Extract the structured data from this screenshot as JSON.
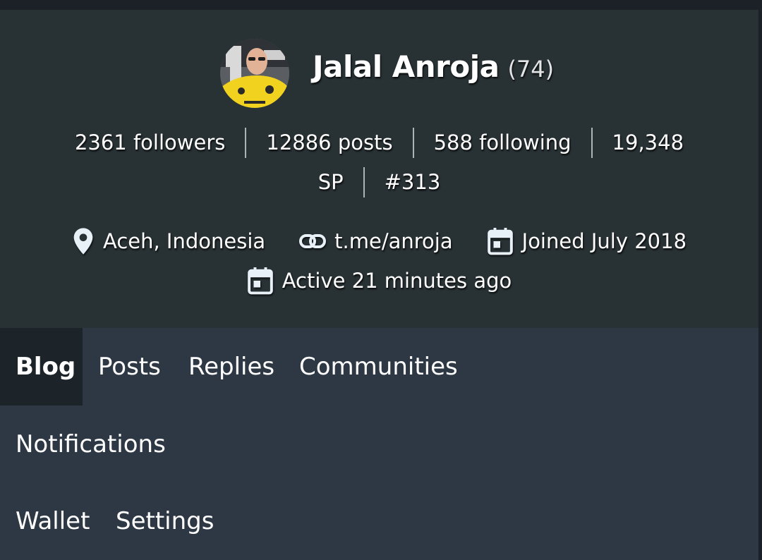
{
  "profile": {
    "name": "Jalal Anroja",
    "reputation": "(74)"
  },
  "stats": {
    "followers": "2361 followers",
    "posts": "12886 posts",
    "following": "588 following",
    "sp_value": "19,348",
    "sp_unit": "SP",
    "rank": "#313"
  },
  "info": {
    "location": "Aceh, Indonesia",
    "website": "t.me/anroja",
    "joined": "Joined July 2018",
    "active": "Active 21 minutes ago",
    "icons": [
      "location-pin-icon",
      "link-icon",
      "calendar-icon",
      "calendar-icon"
    ]
  },
  "tabs": {
    "items": [
      "Blog",
      "Posts",
      "Replies",
      "Communities",
      "Notifications",
      "Wallet",
      "Settings"
    ],
    "active": "Blog"
  },
  "colors": {
    "header_bg": "#283134",
    "tabs_bg": "#2d3844",
    "active_tab_bg": "#1c2329",
    "icon_color": "#e8f0f8"
  }
}
